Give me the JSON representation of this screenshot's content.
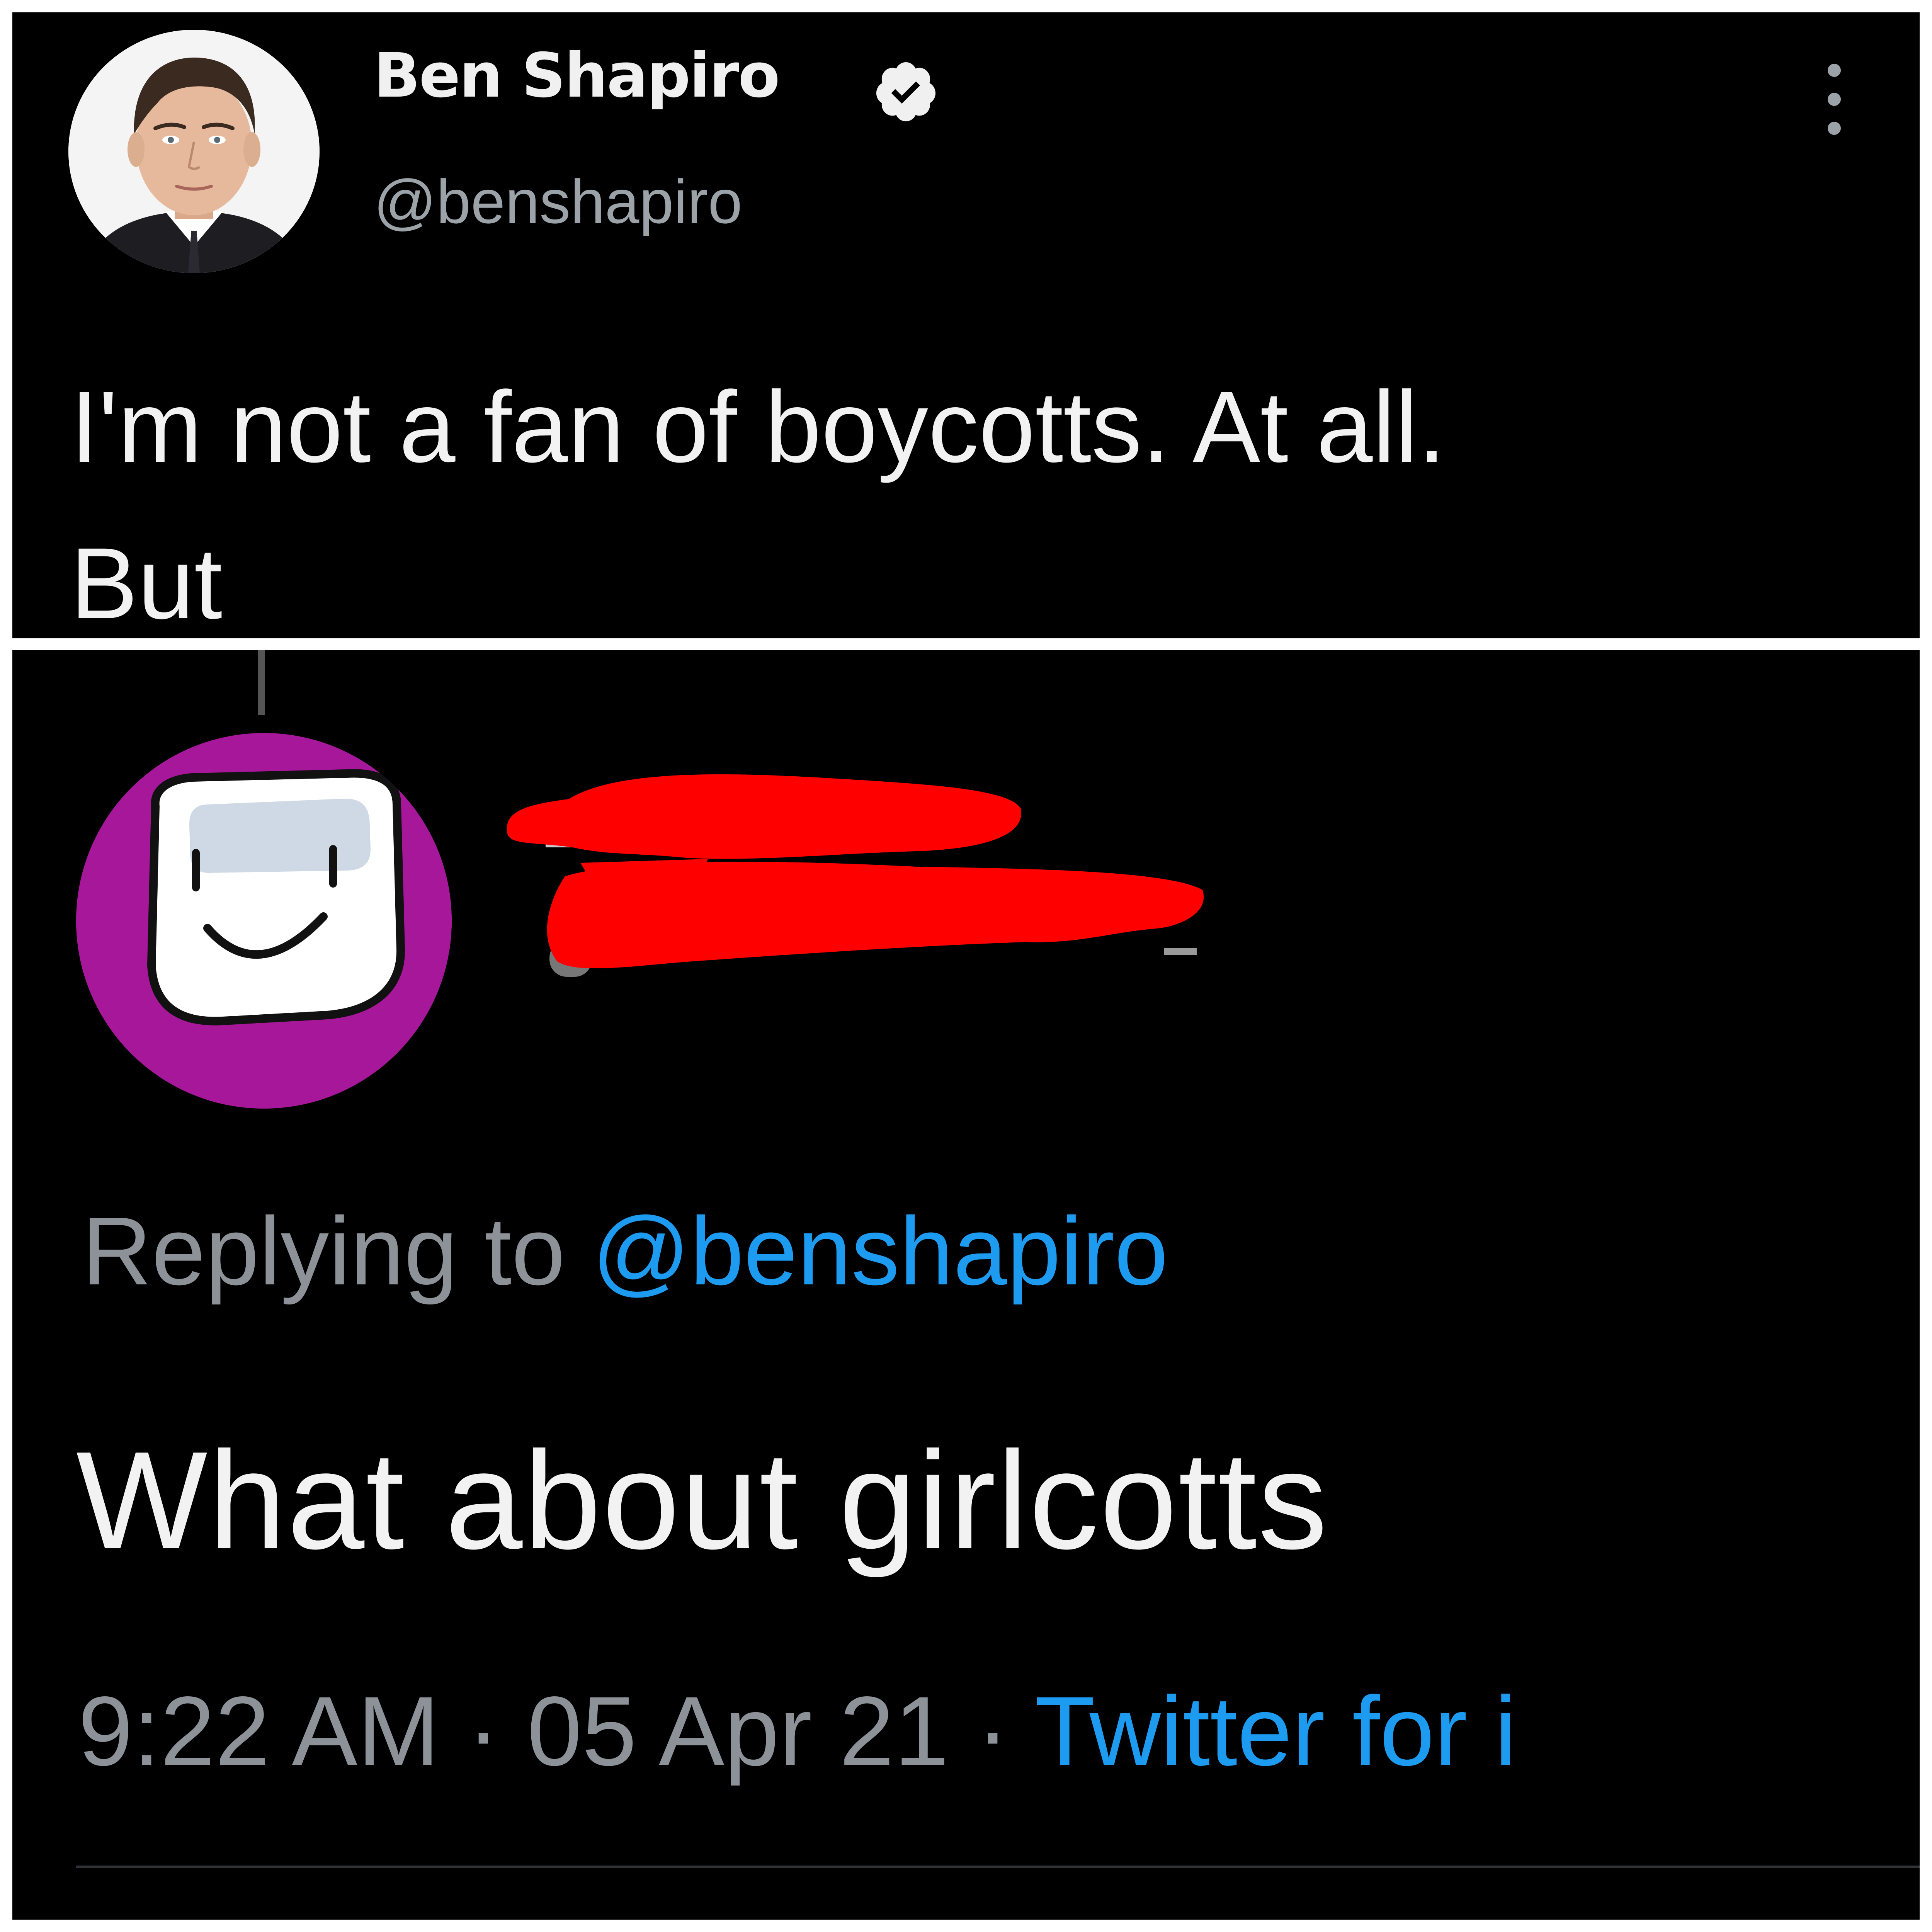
{
  "tweet": {
    "author_name": "Ben Shapiro",
    "author_handle": "@benshapiro",
    "verified": true,
    "text_line1": "I'm not a fan of boycotts. At all.",
    "text_line2": "But"
  },
  "reply": {
    "avatar_color": "#a7179a",
    "name": "",
    "handle": "",
    "redaction_color": "#ff0000",
    "replying_prefix": "Replying to",
    "replying_handle": "@benshapiro",
    "text": "What about girlcotts",
    "time": "9:22 AM",
    "separator": "·",
    "date": "05 Apr 21",
    "source": "Twitter for i"
  },
  "colors": {
    "background": "#000000",
    "primary_text": "#f2f2f2",
    "secondary_text": "#8c9297",
    "link": "#1d9bf0"
  },
  "icons": {
    "verified": "verified-badge-icon",
    "more": "more-vertical-icon"
  }
}
